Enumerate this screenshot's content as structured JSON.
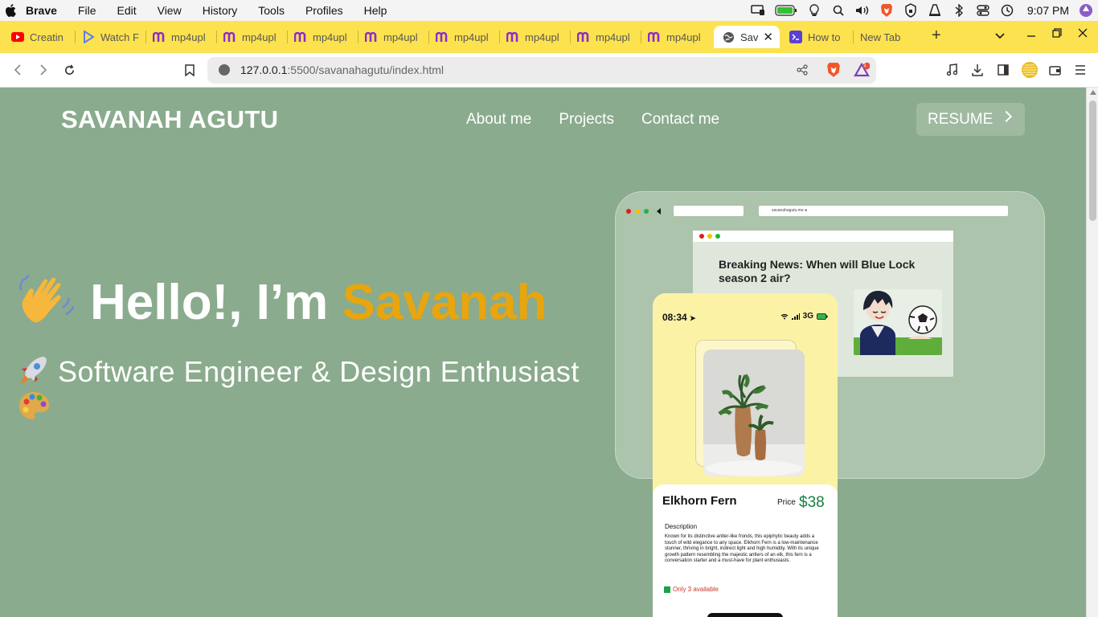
{
  "menubar": {
    "app": "Brave",
    "items": [
      "File",
      "Edit",
      "View",
      "History",
      "Tools",
      "Profiles",
      "Help"
    ],
    "clock": "9:07 PM"
  },
  "tabs": [
    {
      "label": "Creatin",
      "icon": "youtube-icon"
    },
    {
      "label": "Watch F",
      "icon": "play-icon"
    },
    {
      "label": "mp4upl",
      "icon": "m-logo-icon"
    },
    {
      "label": "mp4upl",
      "icon": "m-logo-icon"
    },
    {
      "label": "mp4upl",
      "icon": "m-logo-icon"
    },
    {
      "label": "mp4upl",
      "icon": "m-logo-icon"
    },
    {
      "label": "mp4upl",
      "icon": "m-logo-icon"
    },
    {
      "label": "mp4upl",
      "icon": "m-logo-icon"
    },
    {
      "label": "mp4upl",
      "icon": "m-logo-icon"
    },
    {
      "label": "mp4upl",
      "icon": "m-logo-icon"
    },
    {
      "label": "Sav",
      "icon": "globe-icon",
      "active": true
    },
    {
      "label": "How to",
      "icon": "terminal-icon"
    },
    {
      "label": "New Tab",
      "icon": ""
    }
  ],
  "address": {
    "host": "127.0.0.1",
    "path": ":5500/savanahagutu/index.html",
    "badge_count": "1"
  },
  "site": {
    "brand": "SAVANAH AGUTU",
    "nav": [
      "About me",
      "Projects",
      "Contact me"
    ],
    "resume": "RESUME",
    "hello_prefix": "Hello!, I’m ",
    "hello_name": "Savanah",
    "tagline": "Software Engineer & Design Enthusiast",
    "accent": "#e8a50d"
  },
  "mockup": {
    "url_text": "savanahagutu.me",
    "headline": "Breaking News:  When will Blue Lock season 2 air?",
    "phone_time": "08:34",
    "phone_network": "3G",
    "product_name": "Elkhorn Fern",
    "price_label": "Price",
    "price": "$38",
    "desc_label": "Description",
    "description": "Known for its distinctive antler-like fronds, this epiphytic beauty adds a touch of wild elegance to any space. Elkhorn Fern is a low-maintenance stunner, thriving in bright, indirect light and high humidity. With its unique growth pattern resembling the majestic antlers of an elk, this fern is a conversation starter and a must-have for plant enthusiasts.",
    "availability": "Only 3 available"
  }
}
